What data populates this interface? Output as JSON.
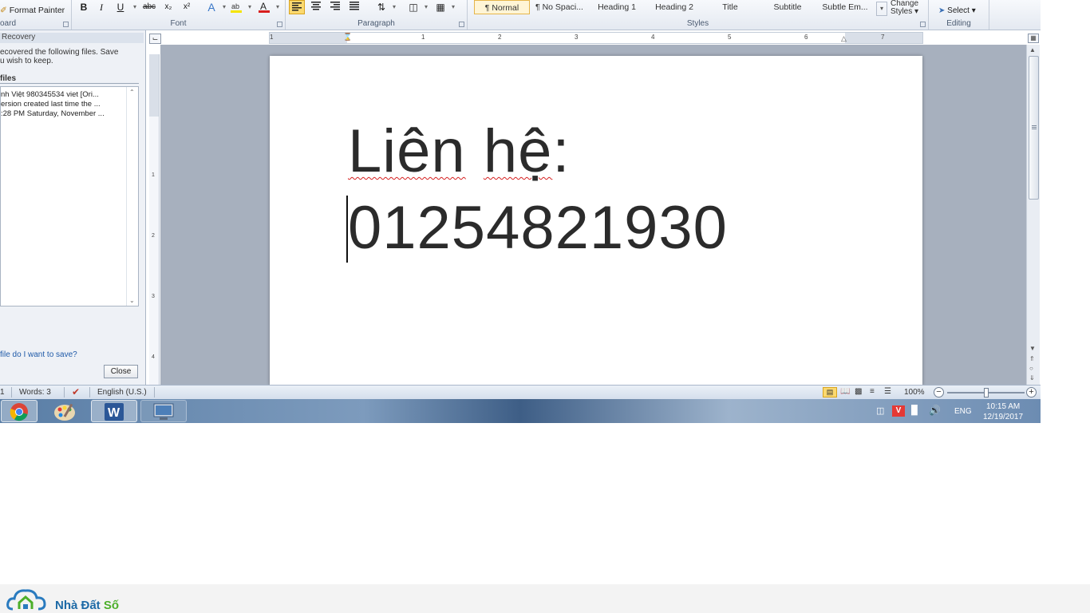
{
  "ribbon": {
    "clipboard": {
      "format_painter": "Format Painter",
      "label": "oard"
    },
    "font": {
      "label": "Font",
      "bold": "B",
      "italic": "I",
      "underline": "U",
      "strike": "abc",
      "subscript": "x₂",
      "superscript": "x²"
    },
    "paragraph": {
      "label": "Paragraph"
    },
    "styles": {
      "label": "Styles",
      "items": [
        "¶ Normal",
        "¶ No Spaci...",
        "Heading 1",
        "Heading 2",
        "Title",
        "Subtitle",
        "Subtle Em..."
      ],
      "change_styles_line1": "Change",
      "change_styles_line2": "Styles ▾"
    },
    "editing": {
      "label": "Editing",
      "select": "Select ▾"
    }
  },
  "recovery_panel": {
    "title": "Recovery",
    "desc_line1": "ecovered the following files.  Save",
    "desc_line2": "u wish to keep.",
    "files_header": "files",
    "file_line1": "nh Việt 980345534 viet  [Ori...",
    "file_line2": "ersion created last time the ...",
    "file_line3": ":28 PM Saturday, November ...",
    "help_link": "file do I want to save?",
    "close_button": "Close"
  },
  "ruler": {
    "h_numbers": [
      "1",
      "1",
      "2",
      "3",
      "4",
      "5",
      "6",
      "7"
    ],
    "v_numbers": [
      "1",
      "2",
      "3",
      "4"
    ]
  },
  "document": {
    "line1_word1": "Liên",
    "line1_word2": "hệ",
    "line1_colon": ":",
    "line2": "01254821930"
  },
  "statusbar": {
    "page": "1",
    "words": "Words: 3",
    "language": "English (U.S.)",
    "zoom": "100%",
    "zoom_level": 0.5
  },
  "taskbar": {
    "language": "ENG",
    "time": "10:15 AM",
    "date": "12/19/2017"
  },
  "watermark": {
    "brand_part1": "Nhà Đất ",
    "brand_part2": "Số"
  },
  "colors": {
    "accent": "#fbd96f",
    "link": "#1f5aa8",
    "brand_blue": "#1d6aa6",
    "brand_green": "#4caf2a",
    "squiggle": "#d62020"
  }
}
